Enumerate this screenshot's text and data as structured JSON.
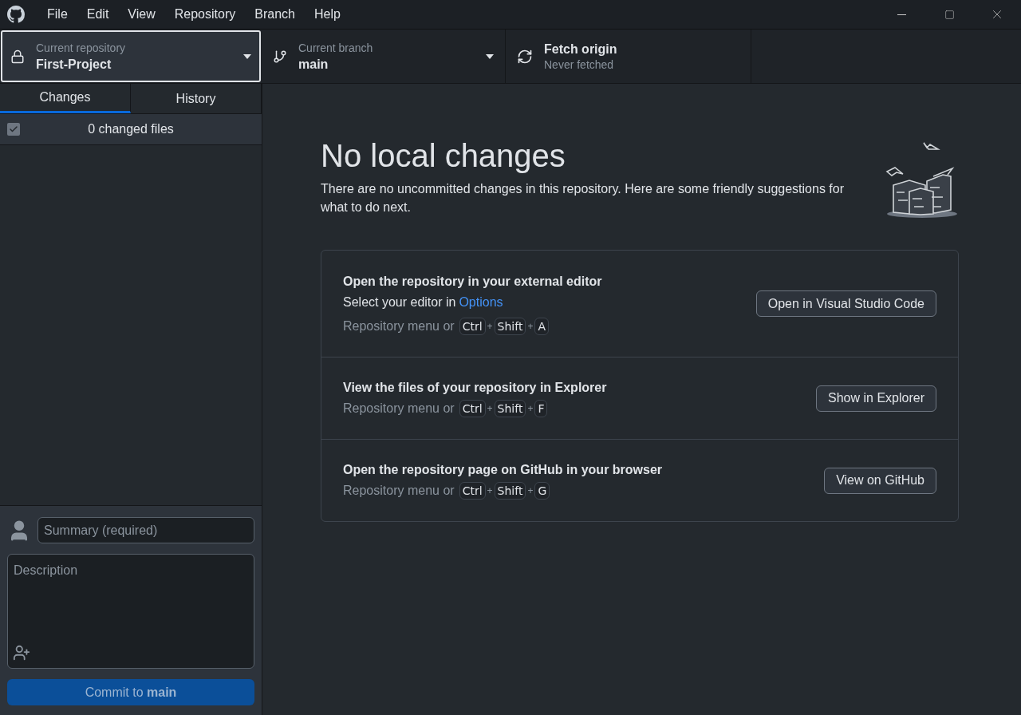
{
  "menu": [
    "File",
    "Edit",
    "View",
    "Repository",
    "Branch",
    "Help"
  ],
  "toolbar": {
    "repository": {
      "label": "Current repository",
      "value": "First-Project",
      "selected": true
    },
    "branch": {
      "label": "Current branch",
      "value": "main"
    },
    "fetch": {
      "label": "Fetch origin",
      "value": "Never fetched"
    }
  },
  "tabs": [
    {
      "label": "Changes",
      "selected": true
    },
    {
      "label": "History",
      "selected": false
    }
  ],
  "changes": {
    "label": "0 changed files",
    "checked": true
  },
  "commit": {
    "summary_placeholder": "Summary (required)",
    "description_placeholder": "Description",
    "button": "Commit to **main**",
    "disabled": true
  },
  "main": {
    "heading": "No local changes",
    "subtitle": "There are no uncommitted changes in this repository. Here are some friendly suggestions for what to do next.",
    "suggestions": [
      {
        "title": "Open the repository in your external editor",
        "description": "Select your editor in",
        "link": "Options",
        "prefix": "Repository menu or",
        "shortcut": [
          {
            "kind": "key",
            "text": "Ctrl"
          },
          {
            "kind": "plus",
            "text": "+"
          },
          {
            "kind": "key",
            "text": "Shift"
          },
          {
            "kind": "plus",
            "text": "+"
          },
          {
            "kind": "key",
            "text": "A"
          }
        ],
        "button": "Open in Visual Studio Code"
      },
      {
        "title": "View the files of your repository in Explorer",
        "prefix": "Repository menu or",
        "shortcut": [
          {
            "kind": "key",
            "text": "Ctrl"
          },
          {
            "kind": "plus",
            "text": "+"
          },
          {
            "kind": "key",
            "text": "Shift"
          },
          {
            "kind": "plus",
            "text": "+"
          },
          {
            "kind": "key",
            "text": "F"
          }
        ],
        "button": "Show in Explorer"
      },
      {
        "title": "Open the repository page on GitHub in your browser",
        "prefix": "Repository menu or",
        "shortcut": [
          {
            "kind": "key",
            "text": "Ctrl"
          },
          {
            "kind": "plus",
            "text": "+"
          },
          {
            "kind": "key",
            "text": "Shift"
          },
          {
            "kind": "plus",
            "text": "+"
          },
          {
            "kind": "key",
            "text": "G"
          }
        ],
        "button": "View on GitHub"
      }
    ]
  }
}
